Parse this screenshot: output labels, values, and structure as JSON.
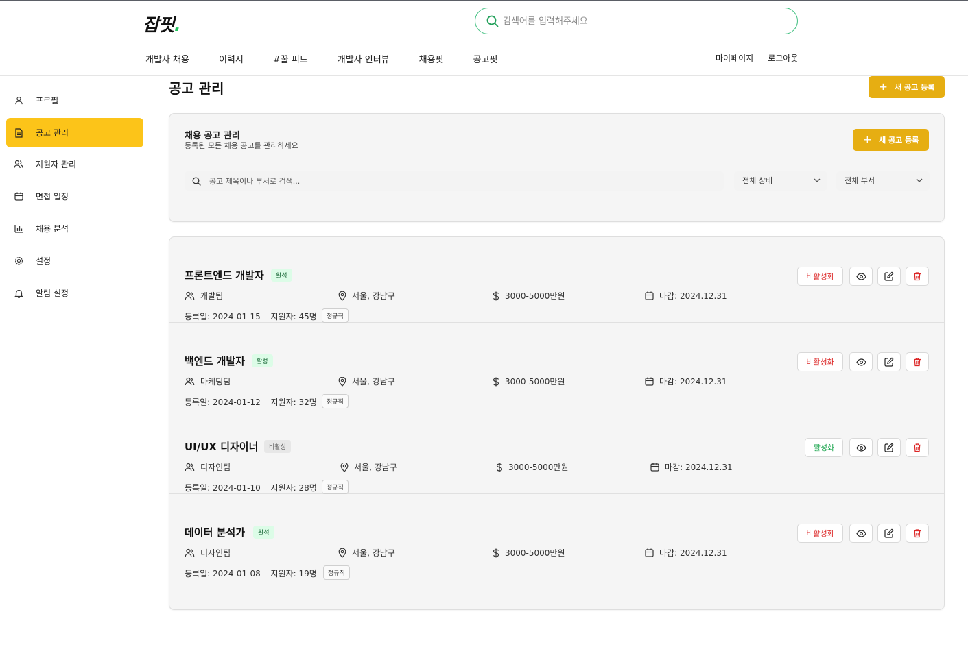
{
  "header": {
    "logo": "잡핏",
    "logo_dot": ".",
    "search_placeholder": "검색어를 입력해주세요",
    "nav": [
      "개발자 채용",
      "이력서",
      "#꿀 피드",
      "개발자 인터뷰",
      "채용핏",
      "공고핏"
    ],
    "user_links": [
      "마이페이지",
      "로그아웃"
    ]
  },
  "sidebar": {
    "items": [
      {
        "label": "프로필",
        "icon": "user-icon"
      },
      {
        "label": "공고 관리",
        "icon": "document-icon",
        "active": true
      },
      {
        "label": "지원자 관리",
        "icon": "users-icon"
      },
      {
        "label": "면접 일정",
        "icon": "calendar-icon"
      },
      {
        "label": "채용 분석",
        "icon": "bar-chart-icon"
      },
      {
        "label": "설정",
        "icon": "gear-icon"
      },
      {
        "label": "알림 설정",
        "icon": "bell-icon"
      }
    ]
  },
  "main": {
    "title": "공고 관리",
    "new_posting_label": "새 공고 등록",
    "panel": {
      "title": "채용 공고 관리",
      "subtitle": "등록된 모든 채용 공고를 관리하세요",
      "new_posting_label": "새 공고 등록",
      "search_placeholder": "공고 제목이나 부서로 검색...",
      "status_filter": "전체 상태",
      "dept_filter": "전체 부서"
    },
    "jobs": [
      {
        "title": "프론트엔드 개발자",
        "status": "활성",
        "team": "개발팀",
        "location": "서울, 강남구",
        "salary": "3000-5000만원",
        "deadline": "마감: 2024.12.31",
        "registered": "등록일: 2024-01-15",
        "applicants": "지원자: 45명",
        "type": "정규직",
        "toggle": "비활성화"
      },
      {
        "title": "백엔드 개발자",
        "status": "활성",
        "team": "마케팅팀",
        "location": "서울, 강남구",
        "salary": "3000-5000만원",
        "deadline": "마감: 2024.12.31",
        "registered": "등록일: 2024-01-12",
        "applicants": "지원자: 32명",
        "type": "정규직",
        "toggle": "비활성화"
      },
      {
        "title": "UI/UX 디자이너",
        "status": "비활성",
        "team": "디자인팀",
        "location": "서울, 강남구",
        "salary": "3000-5000만원",
        "deadline": "마감: 2024.12.31",
        "registered": "등록일: 2024-01-10",
        "applicants": "지원자: 28명",
        "type": "정규직",
        "toggle": "활성화"
      },
      {
        "title": "데이터 분석가",
        "status": "활성",
        "team": "디자인팀",
        "location": "서울, 강남구",
        "salary": "3000-5000만원",
        "deadline": "마감: 2024.12.31",
        "registered": "등록일: 2024-01-08",
        "applicants": "지원자: 19명",
        "type": "정규직",
        "toggle": "비활성화"
      }
    ]
  },
  "colors": {
    "accent": "#fcc419",
    "button": "#e6ae12",
    "search_border": "#3fbf7f",
    "danger": "#dc2626",
    "success": "#16a34a"
  }
}
